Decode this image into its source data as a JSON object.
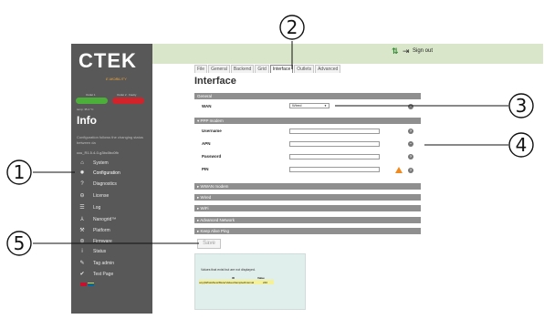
{
  "brand": {
    "logo": "CTEK",
    "tagline": "E-MOBILITY"
  },
  "connectors": [
    {
      "label": "Outlet 1",
      "color": "#4caf3a"
    },
    {
      "label": "Outlet 2 · Faulty",
      "color": "#d2232a"
    }
  ],
  "sidebar": {
    "temp": "temp: 35.4 °C",
    "info_title": "Info",
    "info_text": "Configuration follows the changing status between da",
    "firmware": "ccu_R1.5.4-0-g3bc0bc0fb",
    "items": [
      {
        "label": "System",
        "icon": "home-icon"
      },
      {
        "label": "Configuration",
        "icon": "gear-icon"
      },
      {
        "label": "Diagnostics",
        "icon": "question-icon"
      },
      {
        "label": "License",
        "icon": "lock-icon"
      },
      {
        "label": "Log",
        "icon": "list-icon"
      },
      {
        "label": "Nanogrid™",
        "icon": "nanogrid-icon"
      },
      {
        "label": "Platform",
        "icon": "wrench-icon"
      },
      {
        "label": "Firmware",
        "icon": "firmware-icon"
      },
      {
        "label": "Status",
        "icon": "info-icon"
      },
      {
        "label": "Tag admin",
        "icon": "tag-icon"
      },
      {
        "label": "Test Page",
        "icon": "check-icon"
      }
    ]
  },
  "topbar": {
    "signout_label": "Sign out"
  },
  "tabs": [
    "File",
    "General",
    "Backend",
    "Grid",
    "Interface",
    "Outlets",
    "Advanced"
  ],
  "page_title": "Interface",
  "general": {
    "header": "General",
    "wan_label": "WAN",
    "wan_value": "Wired"
  },
  "ppp": {
    "header": "▾ PPP modem",
    "fields": [
      {
        "label": "Username",
        "value": ""
      },
      {
        "label": "APN",
        "value": ""
      },
      {
        "label": "Password",
        "value": ""
      },
      {
        "label": "PIN",
        "value": ""
      }
    ]
  },
  "collapsed_sections": [
    "▸ WWAN modem",
    "▸ Wired",
    "▸ WiFi",
    "▸ Advanced Network",
    "▸ Keep Alive Ping"
  ],
  "save_label": "Save",
  "info_box": {
    "text": "Values that exist but are not displayed.",
    "col_id": "ID",
    "col_value": "Value",
    "row_id": "ocppWhatsNew/MeterValuesSampledInterval",
    "row_value": "240"
  },
  "callouts": [
    "1",
    "2",
    "3",
    "4",
    "5"
  ]
}
